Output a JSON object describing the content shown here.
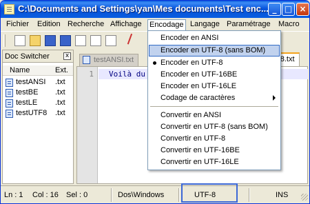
{
  "window": {
    "title": "C:\\Documents and Settings\\yan\\Mes documents\\Test enc...",
    "buttons": {
      "minimize": "_",
      "maximize": "□",
      "close": "×"
    }
  },
  "menubar": {
    "items": [
      "Fichier",
      "Edition",
      "Recherche",
      "Affichage",
      "Encodage",
      "Langage",
      "Paramétrage",
      "Macro"
    ]
  },
  "docswitcher": {
    "title": "Doc Switcher",
    "close": "x",
    "columns": {
      "name": "Name",
      "ext": "Ext."
    },
    "files": [
      {
        "name": "testANSI",
        "ext": ".txt"
      },
      {
        "name": "testBE",
        "ext": ".txt"
      },
      {
        "name": "testLE",
        "ext": ".txt"
      },
      {
        "name": "testUTF8",
        "ext": ".txt"
      }
    ]
  },
  "tabs": [
    {
      "label": "testANSI.txt"
    },
    {
      "label": "F8.txt"
    }
  ],
  "editor": {
    "line_number": "1",
    "text": "Voilà du"
  },
  "encoding_menu": {
    "group1": [
      "Encoder en ANSI",
      "Encoder en UTF-8 (sans BOM)",
      "Encoder en UTF-8",
      "Encoder en UTF-16BE",
      "Encoder en UTF-16LE",
      "Codage de caractères"
    ],
    "group2": [
      "Convertir en ANSI",
      "Convertir en UTF-8 (sans BOM)",
      "Convertir en UTF-8",
      "Convertir en UTF-16BE",
      "Convertir en UTF-16LE"
    ],
    "highlighted": "Encoder en UTF-8 (sans BOM)",
    "checked": "Encoder en UTF-8"
  },
  "statusbar": {
    "line": "Ln : 1",
    "col": "Col : 16",
    "sel": "Sel : 0",
    "eol": "Dos\\Windows",
    "encoding": "UTF-8",
    "mode": "INS"
  }
}
